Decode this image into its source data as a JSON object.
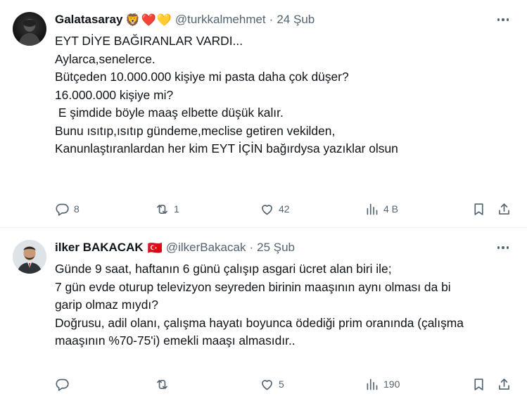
{
  "tweets": [
    {
      "display_name": "Galatasaray",
      "emojis": [
        "🦁",
        "❤️",
        "💛"
      ],
      "handle": "@turkkalmehmet",
      "separator": "·",
      "time": "24 Şub",
      "text": [
        "EYT DİYE BAĞIRANLAR VARDI...",
        "Aylarca,senelerce.",
        "",
        "Bütçeden 10.000.000 kişiye mi pasta daha çok düşer?",
        "16.000.000 kişiye mi?",
        " E şimdide böyle maaş elbette düşük kalır.",
        "",
        "Bunu ısıtıp,ısıtıp gündeme,meclise getiren vekilden,",
        "Kanunlaştıranlardan her kim EYT İÇİN bağırdysa yazıklar olsun"
      ],
      "replies": "8",
      "retweets": "1",
      "likes": "42",
      "views": "4 B",
      "avatar_icon": "user-avatar"
    },
    {
      "display_name": "ilker BAKACAK",
      "emojis": [
        "🇹🇷"
      ],
      "handle": "@ilkerBakacak",
      "separator": "·",
      "time": "25 Şub",
      "text": [
        "Günde 9 saat, haftanın 6 günü çalışıp asgari ücret alan biri ile;",
        "7 gün evde oturup televizyon seyreden birinin maaşının aynı olması da bi",
        "garip olmaz mıydı?",
        "",
        "Doğrusu, adil olanı, çalışma hayatı boyunca ödediği prim oranında (çalışma",
        "maaşının %70-75'i) emekli maaşı almasıdır.."
      ],
      "replies": "",
      "retweets": "",
      "likes": "5",
      "views": "190",
      "avatar_icon": "user-avatar"
    }
  ],
  "icons": {
    "reply": "reply-icon",
    "retweet": "retweet-icon",
    "like": "like-icon",
    "views": "views-icon",
    "bookmark": "bookmark-icon",
    "share": "share-icon",
    "more": "more-icon"
  }
}
